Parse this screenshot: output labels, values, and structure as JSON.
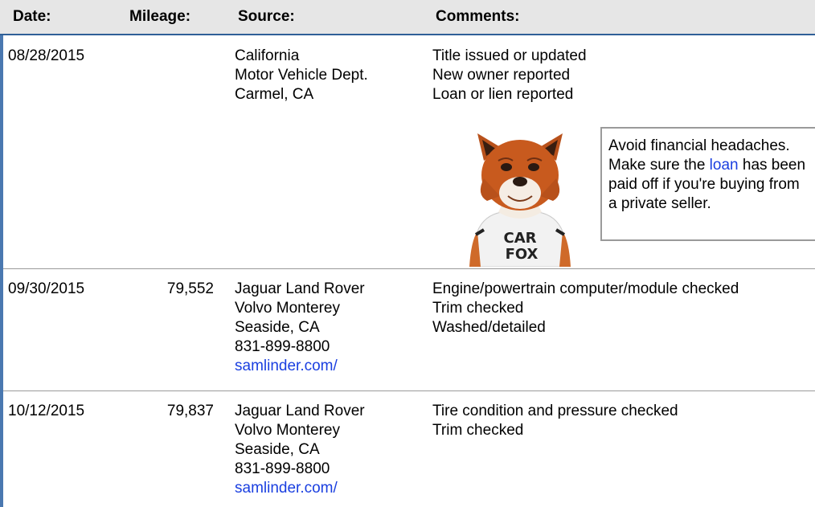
{
  "header": {
    "date": "Date:",
    "mileage": "Mileage:",
    "source": "Source:",
    "comments": "Comments:"
  },
  "records": [
    {
      "date": "08/28/2015",
      "mileage": "",
      "source": [
        "California",
        "Motor Vehicle Dept.",
        "Carmel, CA"
      ],
      "link": "",
      "comments": [
        "Title issued or updated",
        "New owner reported",
        "Loan or lien reported"
      ]
    },
    {
      "date": "09/30/2015",
      "mileage": "79,552",
      "source": [
        "Jaguar Land Rover",
        "Volvo Monterey",
        "Seaside, CA",
        "831-899-8800"
      ],
      "link": "samlinder.com/",
      "comments": [
        "Engine/powertrain computer/module checked",
        "Trim checked",
        "Washed/detailed"
      ]
    },
    {
      "date": "10/12/2015",
      "mileage": "79,837",
      "source": [
        "Jaguar Land Rover",
        "Volvo Monterey",
        "Seaside, CA",
        "831-899-8800"
      ],
      "link": "samlinder.com/",
      "comments": [
        "Tire condition and pressure checked",
        "Trim checked"
      ]
    }
  ],
  "tip": {
    "before": "Avoid financial headaches. Make sure the ",
    "link": "loan",
    "after": " has been paid off if you're buying from a private seller."
  },
  "mascot": {
    "shirt_line1": "CAR",
    "shirt_line2": "FOX"
  },
  "colors": {
    "header_bg": "#e6e6e6",
    "accent_blue": "#2f5f97",
    "link": "#1a3fe0",
    "fox_orange": "#c85a1e"
  }
}
